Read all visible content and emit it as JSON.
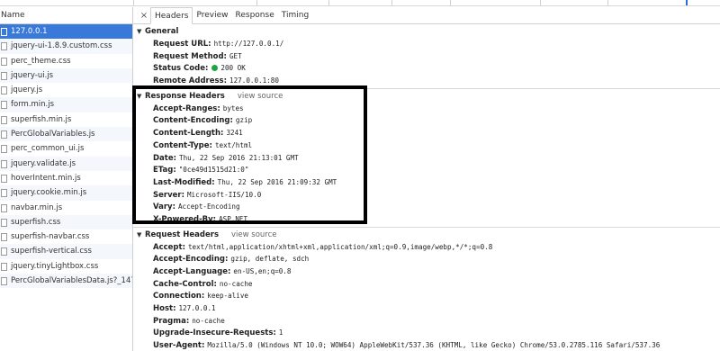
{
  "sidebar": {
    "header": "Name",
    "files": [
      {
        "name": "127.0.0.1",
        "selected": true
      },
      {
        "name": "jquery-ui-1.8.9.custom.css"
      },
      {
        "name": "perc_theme.css"
      },
      {
        "name": "jquery-ui.js"
      },
      {
        "name": "jquery.js"
      },
      {
        "name": "form.min.js"
      },
      {
        "name": "superfish.min.js"
      },
      {
        "name": "PercGlobalVariables.js"
      },
      {
        "name": "perc_common_ui.js"
      },
      {
        "name": "jquery.validate.js"
      },
      {
        "name": "hoverIntent.min.js"
      },
      {
        "name": "jquery.cookie.min.js"
      },
      {
        "name": "navbar.min.js"
      },
      {
        "name": "superfish.css"
      },
      {
        "name": "superfish-navbar.css"
      },
      {
        "name": "superfish-vertical.css"
      },
      {
        "name": "jquery.tinyLightbox.css"
      },
      {
        "name": "PercGlobalVariablesData.js?_1474..."
      }
    ]
  },
  "tabs": {
    "close": "×",
    "items": [
      "Headers",
      "Preview",
      "Response",
      "Timing"
    ],
    "active": "Headers"
  },
  "general": {
    "title": "General",
    "rows": [
      {
        "key": "Request URL:",
        "value": "http://127.0.0.1/"
      },
      {
        "key": "Request Method:",
        "value": "GET"
      },
      {
        "key": "Status Code:",
        "value": "200 OK",
        "status_dot_color": "#1ea446"
      },
      {
        "key": "Remote Address:",
        "value": "127.0.0.1:80"
      }
    ]
  },
  "response_headers": {
    "title": "Response Headers",
    "view_source": "view source",
    "rows": [
      {
        "key": "Accept-Ranges:",
        "value": "bytes"
      },
      {
        "key": "Content-Encoding:",
        "value": "gzip"
      },
      {
        "key": "Content-Length:",
        "value": "3241"
      },
      {
        "key": "Content-Type:",
        "value": "text/html"
      },
      {
        "key": "Date:",
        "value": "Thu, 22 Sep 2016 21:13:01 GMT"
      },
      {
        "key": "ETag:",
        "value": "\"0ce49d1515d21:0\""
      },
      {
        "key": "Last-Modified:",
        "value": "Thu, 22 Sep 2016 21:09:32 GMT"
      },
      {
        "key": "Server:",
        "value": "Microsoft-IIS/10.0"
      },
      {
        "key": "Vary:",
        "value": "Accept-Encoding"
      },
      {
        "key": "X-Powered-By:",
        "value": "ASP.NET"
      }
    ]
  },
  "request_headers": {
    "title": "Request Headers",
    "view_source": "view source",
    "rows": [
      {
        "key": "Accept:",
        "value": "text/html,application/xhtml+xml,application/xml;q=0.9,image/webp,*/*;q=0.8"
      },
      {
        "key": "Accept-Encoding:",
        "value": "gzip, deflate, sdch"
      },
      {
        "key": "Accept-Language:",
        "value": "en-US,en;q=0.8"
      },
      {
        "key": "Cache-Control:",
        "value": "no-cache"
      },
      {
        "key": "Connection:",
        "value": "keep-alive"
      },
      {
        "key": "Host:",
        "value": "127.0.0.1"
      },
      {
        "key": "Pragma:",
        "value": "no-cache"
      },
      {
        "key": "Upgrade-Insecure-Requests:",
        "value": "1"
      },
      {
        "key": "User-Agent:",
        "value": "Mozilla/5.0 (Windows NT 10.0; WOW64) AppleWebKit/537.36 (KHTML, like Gecko) Chrome/53.0.2785.116 Safari/537.36"
      }
    ]
  }
}
